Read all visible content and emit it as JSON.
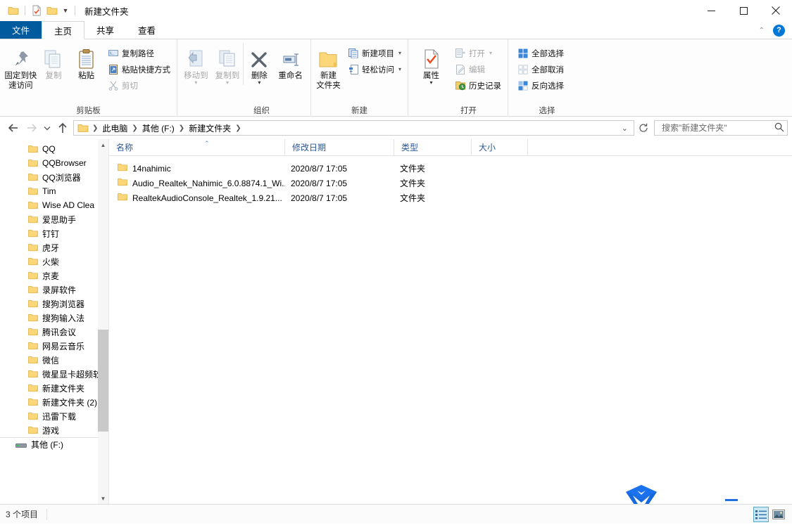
{
  "window": {
    "title": "新建文件夹",
    "quick_access": [
      {
        "name": "folder-icon",
        "label": "文件夹"
      },
      {
        "name": "properties-icon",
        "label": "属性"
      },
      {
        "name": "new-folder-icon",
        "label": "新建文件夹"
      }
    ],
    "controls": {
      "minimize": "最小化",
      "maximize": "最大化",
      "close": "关闭"
    }
  },
  "tabs": [
    {
      "label": "文件",
      "name": "tab-file"
    },
    {
      "label": "主页",
      "name": "tab-home"
    },
    {
      "label": "共享",
      "name": "tab-share"
    },
    {
      "label": "查看",
      "name": "tab-view"
    }
  ],
  "ribbon": {
    "collapse_icon": "chevron-up-icon",
    "help_icon": "help-icon",
    "help_label": "?",
    "groups": [
      {
        "label": "剪贴板",
        "big": [
          {
            "label_line1": "固定到快",
            "label_line2": "速访问",
            "icon": "pin-icon",
            "dim": false
          },
          {
            "label_line1": "复制",
            "label_line2": "",
            "icon": "copy-icon",
            "dim": true
          },
          {
            "label_line1": "粘贴",
            "label_line2": "",
            "icon": "paste-icon",
            "dim": false
          }
        ],
        "small": [
          {
            "label": "复制路径",
            "icon": "copy-path-icon",
            "dim": false
          },
          {
            "label": "粘贴快捷方式",
            "icon": "paste-shortcut-icon",
            "dim": false
          },
          {
            "label": "剪切",
            "icon": "cut-icon",
            "dim": true
          }
        ]
      },
      {
        "label": "组织",
        "big": [
          {
            "label_line1": "移动到",
            "label_line2": "",
            "icon": "move-to-icon",
            "dim": true,
            "caret": true
          },
          {
            "label_line1": "复制到",
            "label_line2": "",
            "icon": "copy-to-icon",
            "dim": true,
            "caret": true
          },
          {
            "label_line1": "删除",
            "label_line2": "",
            "icon": "delete-icon",
            "dim": false,
            "caret": true
          },
          {
            "label_line1": "重命名",
            "label_line2": "",
            "icon": "rename-icon",
            "dim": false
          }
        ]
      },
      {
        "label": "新建",
        "big": [
          {
            "label_line1": "新建",
            "label_line2": "文件夹",
            "icon": "new-folder-icon",
            "dim": false
          }
        ],
        "small": [
          {
            "label": "新建项目",
            "icon": "new-item-icon",
            "dim": false,
            "caret": true
          },
          {
            "label": "轻松访问",
            "icon": "easy-access-icon",
            "dim": false,
            "caret": true
          }
        ]
      },
      {
        "label": "打开",
        "big": [
          {
            "label_line1": "属性",
            "label_line2": "",
            "icon": "properties-icon",
            "dim": false,
            "caret": true
          }
        ],
        "small": [
          {
            "label": "打开",
            "icon": "open-icon",
            "dim": true,
            "caret": true
          },
          {
            "label": "编辑",
            "icon": "edit-icon",
            "dim": true
          },
          {
            "label": "历史记录",
            "icon": "history-icon",
            "dim": false
          }
        ]
      },
      {
        "label": "选择",
        "small": [
          {
            "label": "全部选择",
            "icon": "select-all-icon",
            "dim": false
          },
          {
            "label": "全部取消",
            "icon": "select-none-icon",
            "dim": true
          },
          {
            "label": "反向选择",
            "icon": "invert-selection-icon",
            "dim": false
          }
        ]
      }
    ]
  },
  "address_bar": {
    "back_label": "后退",
    "forward_label": "前进",
    "recent_label": "最近位置",
    "up_label": "上一级",
    "crumbs": [
      "此电脑",
      "其他 (F:)",
      "新建文件夹"
    ],
    "dropdown_icon": "chevron-down-icon",
    "refresh_icon": "refresh-icon",
    "search_placeholder": "搜索\"新建文件夹\"",
    "search_value": "",
    "search_icon": "search-icon"
  },
  "nav_pane": {
    "items": [
      {
        "label": "QQ",
        "icon": "folder-icon"
      },
      {
        "label": "QQBrowser",
        "icon": "folder-icon"
      },
      {
        "label": "QQ浏览器",
        "icon": "folder-icon"
      },
      {
        "label": "Tim",
        "icon": "folder-icon"
      },
      {
        "label": "Wise AD Clea",
        "icon": "folder-icon"
      },
      {
        "label": "爱思助手",
        "icon": "folder-icon"
      },
      {
        "label": "钉钉",
        "icon": "folder-icon"
      },
      {
        "label": "虎牙",
        "icon": "folder-icon"
      },
      {
        "label": "火柴",
        "icon": "folder-icon"
      },
      {
        "label": "京麦",
        "icon": "folder-icon"
      },
      {
        "label": "录屏软件",
        "icon": "folder-icon"
      },
      {
        "label": "搜狗浏览器",
        "icon": "folder-icon"
      },
      {
        "label": "搜狗输入法",
        "icon": "folder-icon"
      },
      {
        "label": "腾讯会议",
        "icon": "folder-icon"
      },
      {
        "label": "网易云音乐",
        "icon": "folder-icon"
      },
      {
        "label": "微信",
        "icon": "folder-icon"
      },
      {
        "label": "微星显卡超频软",
        "icon": "folder-icon"
      },
      {
        "label": "新建文件夹",
        "icon": "folder-icon"
      },
      {
        "label": "新建文件夹 (2)",
        "icon": "folder-icon"
      },
      {
        "label": "迅雷下载",
        "icon": "folder-icon"
      },
      {
        "label": "游戏",
        "icon": "folder-icon"
      }
    ],
    "drive": {
      "label": "其他 (F:)",
      "icon": "drive-icon"
    },
    "scroll_up_icon": "chevron-up-icon",
    "scroll_down_icon": "chevron-down-icon"
  },
  "file_list": {
    "columns": [
      {
        "label": "名称",
        "sorted": "asc"
      },
      {
        "label": "修改日期",
        "sorted": ""
      },
      {
        "label": "类型",
        "sorted": ""
      },
      {
        "label": "大小",
        "sorted": ""
      }
    ],
    "rows": [
      {
        "name": "14nahimic",
        "date": "2020/8/7 17:05",
        "type": "文件夹",
        "size": "",
        "icon": "folder-icon"
      },
      {
        "name": "Audio_Realtek_Nahimic_6.0.8874.1_Wi...",
        "date": "2020/8/7 17:05",
        "type": "文件夹",
        "size": "",
        "icon": "folder-icon"
      },
      {
        "name": "RealtekAudioConsole_Realtek_1.9.21...",
        "date": "2020/8/7 17:05",
        "type": "文件夹",
        "size": "",
        "icon": "folder-icon"
      }
    ]
  },
  "overlay": {
    "logo_name": "security-shield-logo",
    "dash_name": "blue-dash-marker"
  },
  "status_bar": {
    "item_count": "3 个项目",
    "views": [
      {
        "name": "details-view-button",
        "label": "详细信息",
        "active": true
      },
      {
        "name": "large-icons-view-button",
        "label": "大图标",
        "active": false
      }
    ]
  },
  "colors": {
    "accent": "#0078d7",
    "tab_file": "#005a9e",
    "folder_yellow": "#ffd466",
    "column_header_text": "#2b5797",
    "logo_blue": "#1569e0"
  }
}
